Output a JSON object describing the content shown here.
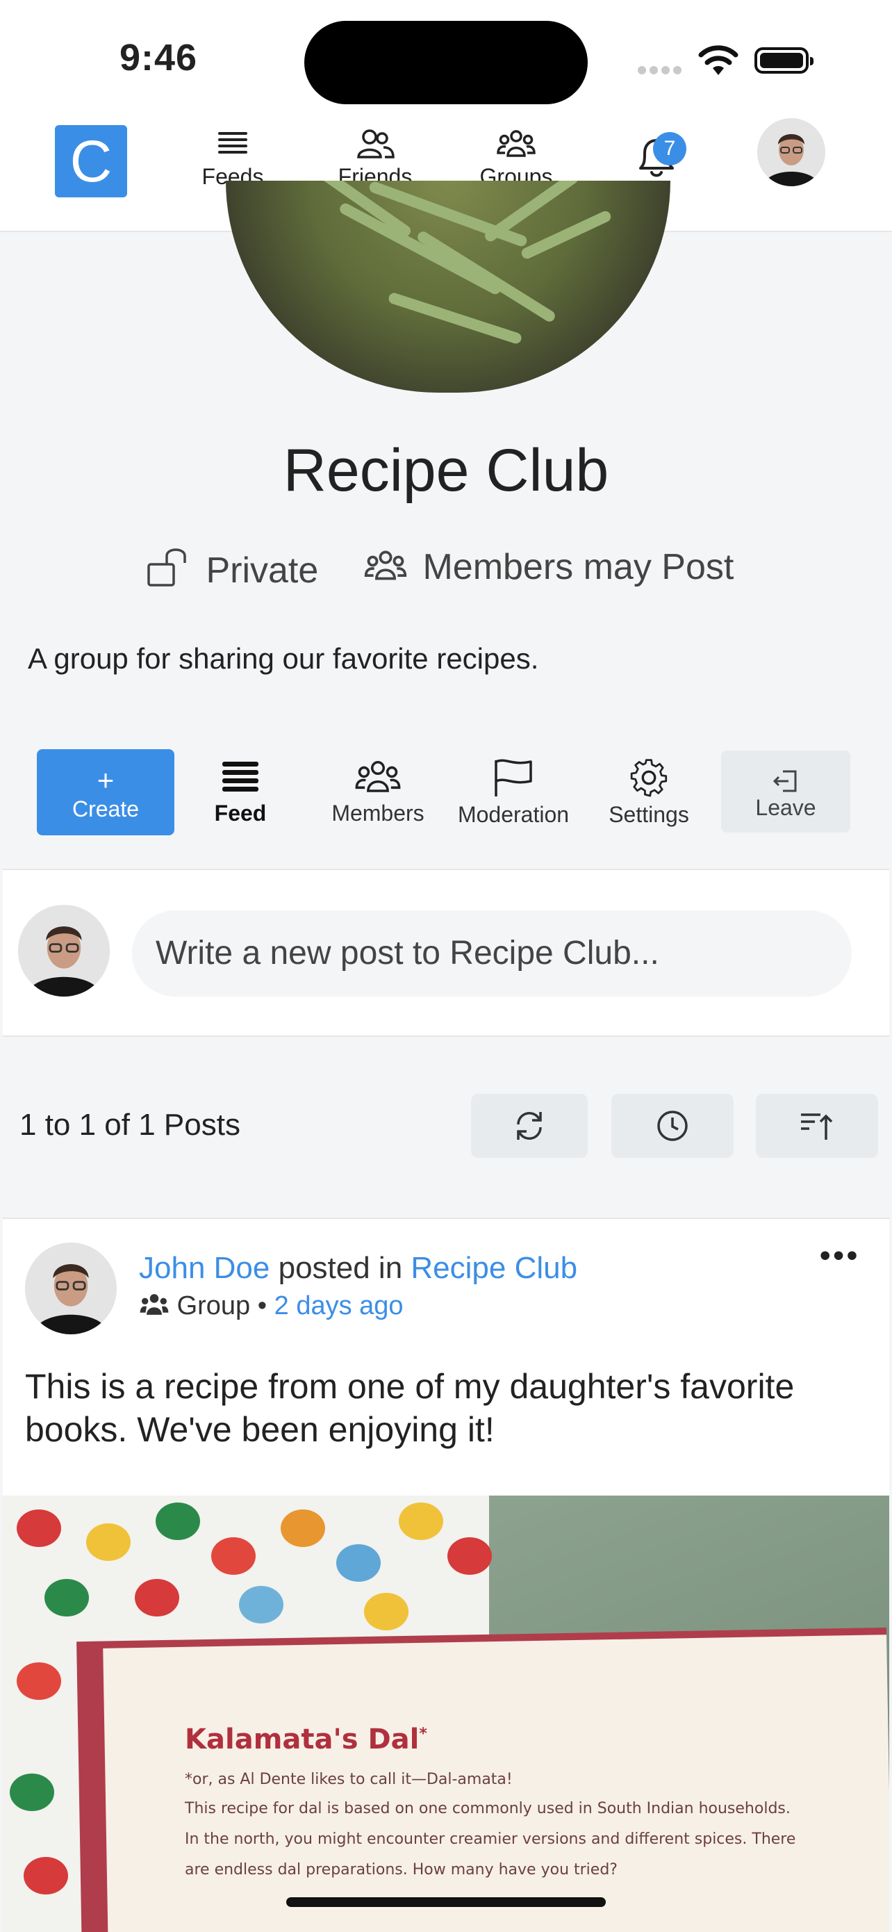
{
  "status_bar": {
    "time": "9:46"
  },
  "nav": {
    "logo": "C",
    "items": [
      {
        "label": "Feeds",
        "icon": "feeds-icon"
      },
      {
        "label": "Friends",
        "icon": "friends-icon"
      },
      {
        "label": "Groups",
        "icon": "groups-icon"
      }
    ],
    "notifications_count": "7"
  },
  "group": {
    "name": "Recipe Club",
    "privacy": "Private",
    "posting": "Members may Post",
    "description": "A group for sharing our favorite recipes."
  },
  "toolbar": {
    "create_plus": "+",
    "create": "Create",
    "feed": "Feed",
    "members": "Members",
    "moderation": "Moderation",
    "settings": "Settings",
    "leave": "Leave"
  },
  "composer": {
    "placeholder": "Write a new post to Recipe Club..."
  },
  "posts": {
    "count_text": "1 to 1 of 1 Posts"
  },
  "post": {
    "author": "John Doe",
    "action": "posted in",
    "group": "Recipe Club",
    "visibility": "Group",
    "separator": "•",
    "time": "2 days ago",
    "menu": "•••",
    "text": "This is a recipe from one of my daughter's favorite books. We've been enjoying it!",
    "image": {
      "title": "Kalamata's Dal",
      "title_mark": "*",
      "lines": [
        "*or, as Al Dente likes to call it—Dal-amata!",
        "This recipe for dal is based on one commonly used in South Indian households.",
        "In the north, you might encounter creamier versions and different spices. There",
        "are endless dal preparations. How many have you tried?"
      ]
    }
  },
  "colors": {
    "accent": "#3b8ee6",
    "button_grey": "#e8ebee"
  }
}
